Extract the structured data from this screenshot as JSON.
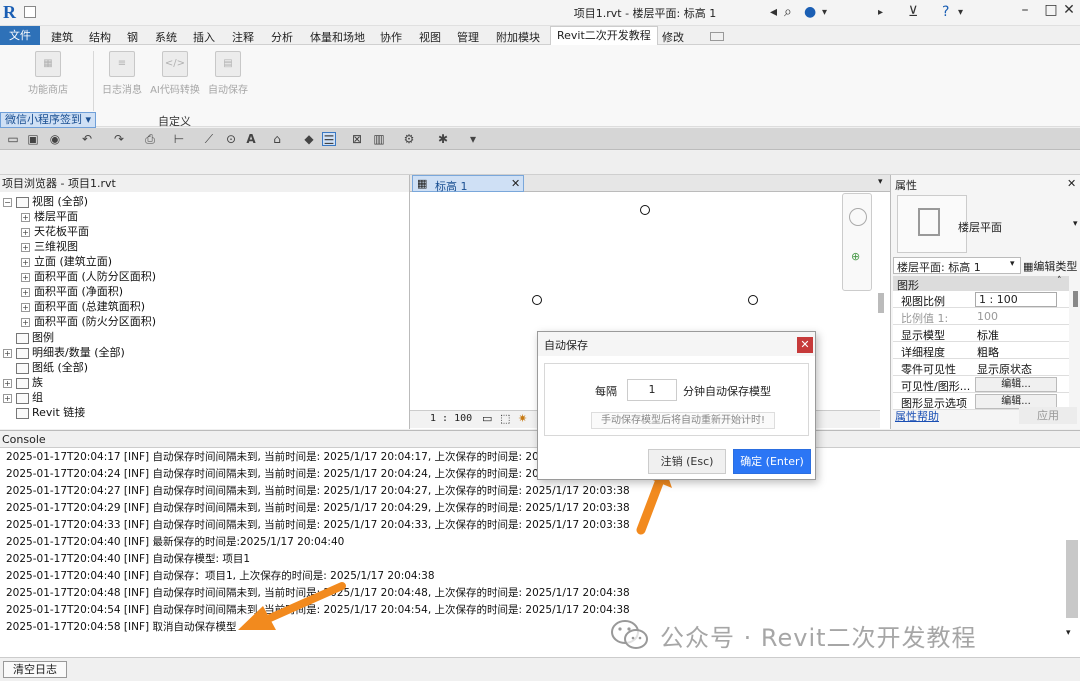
{
  "window": {
    "title": "项目1.rvt - 楼层平面: 标高 1",
    "app_logo": "R"
  },
  "menu": {
    "file": "文件",
    "items": [
      "建筑",
      "结构",
      "钢",
      "系统",
      "插入",
      "注释",
      "分析",
      "体量和场地",
      "协作",
      "视图",
      "管理",
      "附加模块",
      "Revit二次开发教程",
      "修改"
    ],
    "active": "Revit二次开发教程"
  },
  "ribbon": {
    "buttons": [
      {
        "label": "功能商店",
        "icon": "gift-icon"
      },
      {
        "label": "日志消息",
        "icon": "document-icon"
      },
      {
        "label": "AI代码转换",
        "icon": "code-icon"
      },
      {
        "label": "自动保存",
        "icon": "save-icon"
      }
    ],
    "panel_dropdown": "微信小程序签到",
    "panel_title": "自定义"
  },
  "browser": {
    "title": "项目浏览器 - 项目1.rvt",
    "items": [
      {
        "label": "视图 (全部)",
        "level": 0,
        "exp": "−"
      },
      {
        "label": "楼层平面",
        "level": 1,
        "exp": "+"
      },
      {
        "label": "天花板平面",
        "level": 1,
        "exp": "+"
      },
      {
        "label": "三维视图",
        "level": 1,
        "exp": "+"
      },
      {
        "label": "立面 (建筑立面)",
        "level": 1,
        "exp": "+"
      },
      {
        "label": "面积平面 (人防分区面积)",
        "level": 1,
        "exp": "+"
      },
      {
        "label": "面积平面 (净面积)",
        "level": 1,
        "exp": "+"
      },
      {
        "label": "面积平面 (总建筑面积)",
        "level": 1,
        "exp": "+"
      },
      {
        "label": "面积平面 (防火分区面积)",
        "level": 1,
        "exp": "+"
      },
      {
        "label": "图例",
        "level": 0,
        "exp": ""
      },
      {
        "label": "明细表/数量 (全部)",
        "level": 0,
        "exp": "+"
      },
      {
        "label": "图纸 (全部)",
        "level": 0,
        "exp": ""
      },
      {
        "label": "族",
        "level": 0,
        "exp": "+"
      },
      {
        "label": "组",
        "level": 0,
        "exp": "+"
      },
      {
        "label": "Revit 链接",
        "level": 0,
        "exp": ""
      }
    ]
  },
  "view": {
    "tab_label": "标高 1",
    "scale": "1 : 100"
  },
  "properties": {
    "title": "属性",
    "type_name": "楼层平面",
    "instance": "楼层平面: 标高 1",
    "edit_type": "编辑类型",
    "group": "图形",
    "rows": [
      {
        "k": "视图比例",
        "v": "1 : 100",
        "box": true
      },
      {
        "k": "比例值 1:",
        "v": "100",
        "muted": true
      },
      {
        "k": "显示模型",
        "v": "标准"
      },
      {
        "k": "详细程度",
        "v": "粗略"
      },
      {
        "k": "零件可见性",
        "v": "显示原状态"
      },
      {
        "k": "可见性/图形...",
        "v": "编辑...",
        "btn": true
      },
      {
        "k": "图形显示选项",
        "v": "编辑...",
        "btn": true
      }
    ],
    "help": "属性帮助",
    "apply": "应用"
  },
  "console": {
    "title": "Console",
    "lines": [
      "2025-01-17T20:04:17 [INF] 自动保存时间间隔未到,  当前时间是: 2025/1/17 20:04:17,  上次保存的时间是: 2025/1/1",
      "2025-01-17T20:04:24 [INF] 自动保存时间间隔未到,  当前时间是: 2025/1/17 20:04:24,  上次保存的时间是: 2025/1/1",
      "2025-01-17T20:04:27 [INF] 自动保存时间间隔未到,  当前时间是: 2025/1/17 20:04:27,  上次保存的时间是: 2025/1/17 20:03:38",
      "2025-01-17T20:04:29 [INF] 自动保存时间间隔未到,  当前时间是: 2025/1/17 20:04:29,  上次保存的时间是: 2025/1/17 20:03:38",
      "2025-01-17T20:04:33 [INF] 自动保存时间间隔未到,  当前时间是: 2025/1/17 20:04:33,  上次保存的时间是: 2025/1/17 20:03:38",
      "2025-01-17T20:04:40 [INF] 最新保存的时间是:2025/1/17 20:04:40",
      "2025-01-17T20:04:40 [INF] 自动保存模型: 项目1",
      "2025-01-17T20:04:40 [INF] 自动保存：项目1,  上次保存的时间是: 2025/1/17 20:04:38",
      "2025-01-17T20:04:48 [INF] 自动保存时间间隔未到,  当前时间是: 2025/1/17 20:04:48,  上次保存的时间是: 2025/1/17 20:04:38",
      "2025-01-17T20:04:54 [INF] 自动保存时间间隔未到,  当前时间是: 2025/1/17 20:04:54,  上次保存的时间是: 2025/1/17 20:04:38",
      "2025-01-17T20:04:58 [INF] 取消自动保存模型"
    ],
    "clear": "清空日志"
  },
  "dialog": {
    "title": "自动保存",
    "prefix": "每隔",
    "interval": "1",
    "suffix": "分钟自动保存模型",
    "hint": "手动保存模型后将自动重新开始计时!",
    "cancel": "注销 (Esc)",
    "ok": "确定 (Enter)"
  },
  "watermark": {
    "text": "公众号 · Revit二次开发教程"
  },
  "colors": {
    "accent": "#2e71b8",
    "ok_button": "#2b76f5",
    "close_button": "#c63a3a",
    "arrow": "#f28a1e"
  }
}
